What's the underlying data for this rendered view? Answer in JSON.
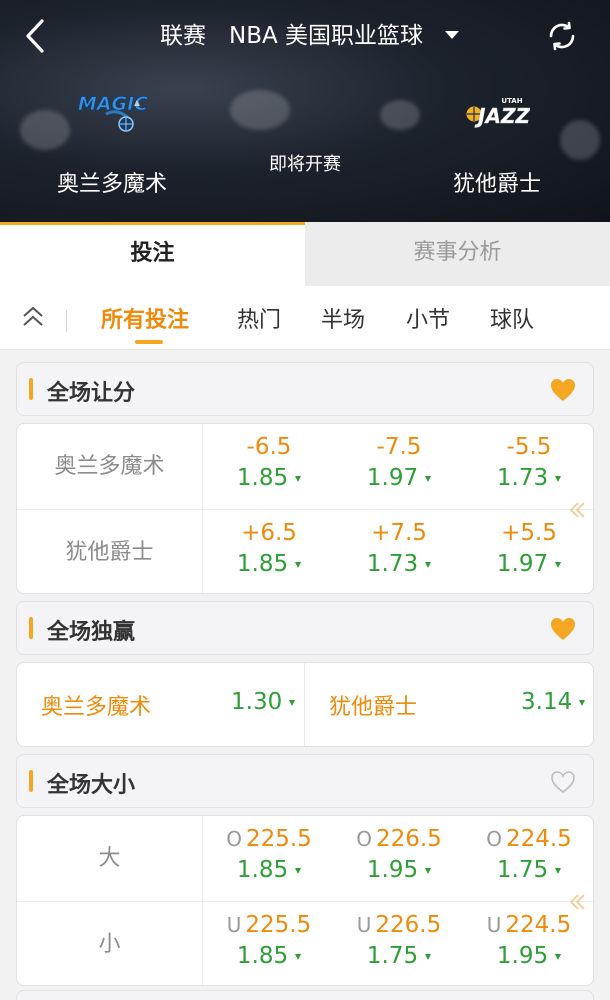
{
  "header": {
    "title": "联赛　NBA 美国职业篮球",
    "home_team": "奥兰多魔术",
    "away_team": "犹他爵士",
    "status": "即将开赛",
    "home_logo_text": "MAGIC",
    "away_logo_text": "JAZZ",
    "away_logo_small": "UTAH"
  },
  "tabs": [
    {
      "label": "投注",
      "active": true
    },
    {
      "label": "赛事分析",
      "active": false
    }
  ],
  "filters": [
    {
      "label": "所有投注",
      "active": true
    },
    {
      "label": "热门",
      "active": false
    },
    {
      "label": "半场",
      "active": false
    },
    {
      "label": "小节",
      "active": false
    },
    {
      "label": "球队",
      "active": false
    }
  ],
  "sections": {
    "handicap": {
      "title": "全场让分",
      "favorite": true,
      "rows": [
        {
          "label": "奥兰多魔术",
          "cells": [
            {
              "line": "-6.5",
              "odds": "1.85"
            },
            {
              "line": "-7.5",
              "odds": "1.97"
            },
            {
              "line": "-5.5",
              "odds": "1.73"
            }
          ]
        },
        {
          "label": "犹他爵士",
          "cells": [
            {
              "line": "+6.5",
              "odds": "1.85"
            },
            {
              "line": "+7.5",
              "odds": "1.73"
            },
            {
              "line": "+5.5",
              "odds": "1.97"
            }
          ]
        }
      ]
    },
    "moneyline": {
      "title": "全场独赢",
      "favorite": true,
      "items": [
        {
          "team": "奥兰多魔术",
          "odds": "1.30"
        },
        {
          "team": "犹他爵士",
          "odds": "3.14"
        }
      ]
    },
    "totals": {
      "title": "全场大小",
      "favorite": false,
      "rows": [
        {
          "label": "大",
          "cells": [
            {
              "prefix": "O",
              "line": "225.5",
              "odds": "1.85"
            },
            {
              "prefix": "O",
              "line": "226.5",
              "odds": "1.95"
            },
            {
              "prefix": "O",
              "line": "224.5",
              "odds": "1.75"
            }
          ]
        },
        {
          "label": "小",
          "cells": [
            {
              "prefix": "U",
              "line": "225.5",
              "odds": "1.85"
            },
            {
              "prefix": "U",
              "line": "226.5",
              "odds": "1.75"
            },
            {
              "prefix": "U",
              "line": "224.5",
              "odds": "1.95"
            }
          ]
        }
      ]
    }
  },
  "colors": {
    "accent": "#f5a623",
    "line_orange": "#f08a0b",
    "odds_green": "#2e9e36"
  }
}
